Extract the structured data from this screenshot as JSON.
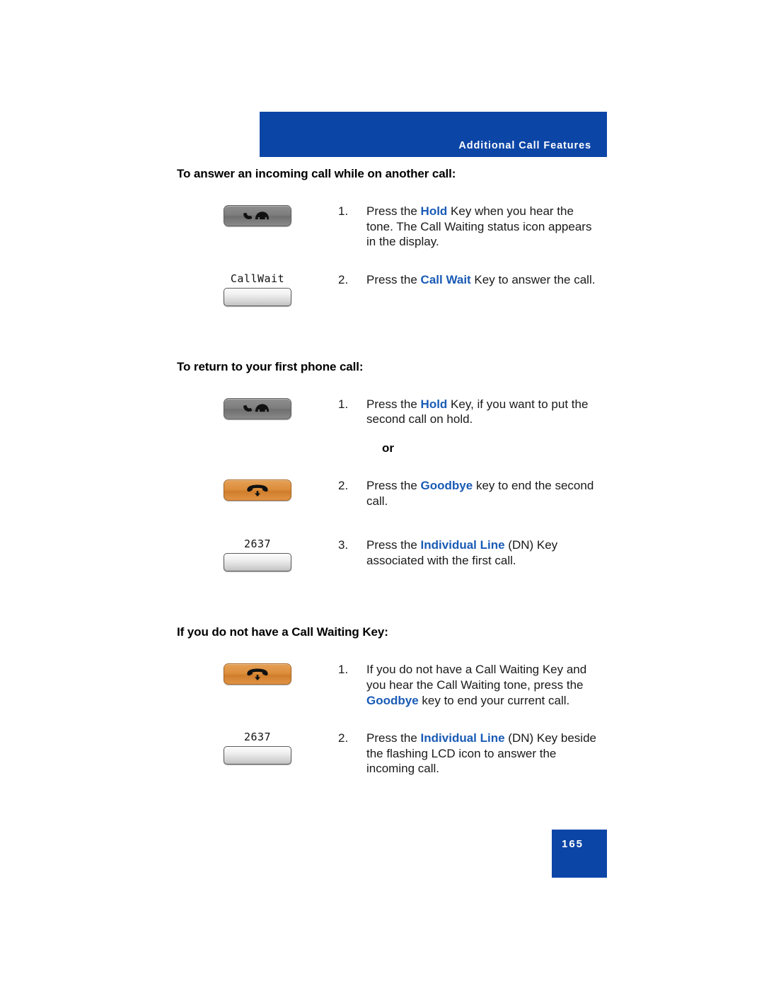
{
  "header": {
    "title": "Additional Call Features",
    "banner_color": "#0b45a6"
  },
  "colors": {
    "banner_blue": "#0b45a6",
    "keyword_blue": "#1a5bb5",
    "goodbye_key_orange": "#dd8f3c",
    "hold_key_gray": "#7e7e7e",
    "softkey_gray": "#d9d9d9"
  },
  "sections": [
    {
      "heading": "To answer an incoming call while on another call:",
      "steps": [
        {
          "number": "1.",
          "art": {
            "type": "fixed-key",
            "variant": "gray",
            "icon": "hold-handset-icon",
            "label": ""
          },
          "text_parts": [
            {
              "t": "Press the ",
              "kw": false
            },
            {
              "t": "Hold",
              "kw": true
            },
            {
              "t": " Key when you hear the tone. The Call Waiting status icon appears in the display.",
              "kw": false
            }
          ]
        },
        {
          "number": "2.",
          "art": {
            "type": "soft-key",
            "variant": "light",
            "icon": "softkey-blank-icon",
            "label": "CallWait"
          },
          "text_parts": [
            {
              "t": "Press the ",
              "kw": false
            },
            {
              "t": "Call Wait",
              "kw": true
            },
            {
              "t": " Key to answer the call.",
              "kw": false
            }
          ]
        }
      ]
    },
    {
      "heading": "To return to your first phone call:",
      "steps": [
        {
          "number": "1.",
          "art": {
            "type": "fixed-key",
            "variant": "gray",
            "icon": "hold-handset-icon",
            "label": ""
          },
          "text_parts": [
            {
              "t": "Press the ",
              "kw": false
            },
            {
              "t": "Hold",
              "kw": true
            },
            {
              "t": " Key, if you want to put the second call on hold.",
              "kw": false
            }
          ],
          "or_after": "or"
        },
        {
          "number": "2.",
          "art": {
            "type": "fixed-key",
            "variant": "orange",
            "icon": "goodbye-handset-icon",
            "label": ""
          },
          "text_parts": [
            {
              "t": "Press the ",
              "kw": false
            },
            {
              "t": "Goodbye",
              "kw": true
            },
            {
              "t": " key to end the second call.",
              "kw": false
            }
          ]
        },
        {
          "number": "3.",
          "art": {
            "type": "soft-key",
            "variant": "light",
            "icon": "softkey-blank-icon",
            "label": "2637"
          },
          "text_parts": [
            {
              "t": "Press the ",
              "kw": false
            },
            {
              "t": "Individual Line",
              "kw": true
            },
            {
              "t": " (DN) Key associated with the first call.",
              "kw": false
            }
          ]
        }
      ]
    },
    {
      "heading": "If you do not have a Call Waiting Key:",
      "steps": [
        {
          "number": "1.",
          "art": {
            "type": "fixed-key",
            "variant": "orange",
            "icon": "goodbye-handset-icon",
            "label": ""
          },
          "text_parts": [
            {
              "t": "If you do not have a Call Waiting Key and you hear the Call Waiting tone, press the ",
              "kw": false
            },
            {
              "t": "Goodbye",
              "kw": true
            },
            {
              "t": " key to end your current call.",
              "kw": false
            }
          ]
        },
        {
          "number": "2.",
          "art": {
            "type": "soft-key",
            "variant": "light",
            "icon": "softkey-blank-icon",
            "label": "2637"
          },
          "text_parts": [
            {
              "t": "Press the ",
              "kw": false
            },
            {
              "t": "Individual Line",
              "kw": true
            },
            {
              "t": " (DN) Key beside the flashing LCD icon to answer the incoming call.",
              "kw": false
            }
          ]
        }
      ]
    }
  ],
  "footer": {
    "page_number": "165"
  }
}
